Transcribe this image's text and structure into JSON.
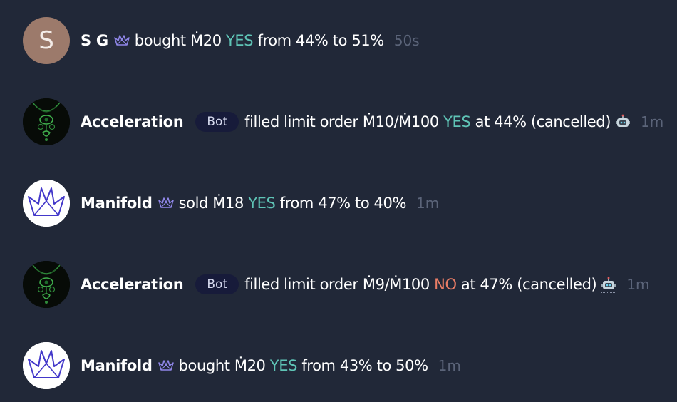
{
  "feed": {
    "items": [
      {
        "avatar": {
          "type": "letter",
          "letter": "S"
        },
        "user": "S G",
        "verified": true,
        "is_bot": false,
        "action": "bought",
        "amount": "Ṁ20",
        "outcome": "YES",
        "detail": "from 44% to 51%",
        "time": "50s"
      },
      {
        "avatar": {
          "type": "bot-image",
          "icon": "acceleration-necklace-icon"
        },
        "user": "Acceleration",
        "verified": false,
        "is_bot": true,
        "badge": "Bot",
        "action": "filled limit order",
        "amount": "Ṁ10/Ṁ100",
        "outcome": "YES",
        "detail": "at 44% (cancelled)",
        "time": "1m"
      },
      {
        "avatar": {
          "type": "manifold-logo",
          "icon": "manifold-crane-logo"
        },
        "user": "Manifold",
        "verified": true,
        "is_bot": false,
        "action": "sold",
        "amount": "Ṁ18",
        "outcome": "YES",
        "detail": "from 47% to 40%",
        "time": "1m"
      },
      {
        "avatar": {
          "type": "bot-image",
          "icon": "acceleration-necklace-icon"
        },
        "user": "Acceleration",
        "verified": false,
        "is_bot": true,
        "badge": "Bot",
        "action": "filled limit order",
        "amount": "Ṁ9/Ṁ100",
        "outcome": "NO",
        "detail": "at 47% (cancelled)",
        "time": "1m"
      },
      {
        "avatar": {
          "type": "manifold-logo",
          "icon": "manifold-crane-logo"
        },
        "user": "Manifold",
        "verified": true,
        "is_bot": false,
        "action": "bought",
        "amount": "Ṁ20",
        "outcome": "YES",
        "detail": "from 43% to 50%",
        "time": "1m"
      }
    ]
  },
  "colors": {
    "background": "#212838",
    "yes": "#5fc4b6",
    "no": "#ea7d66",
    "muted_time": "#5b6479",
    "badge_bg": "#171b3a"
  }
}
